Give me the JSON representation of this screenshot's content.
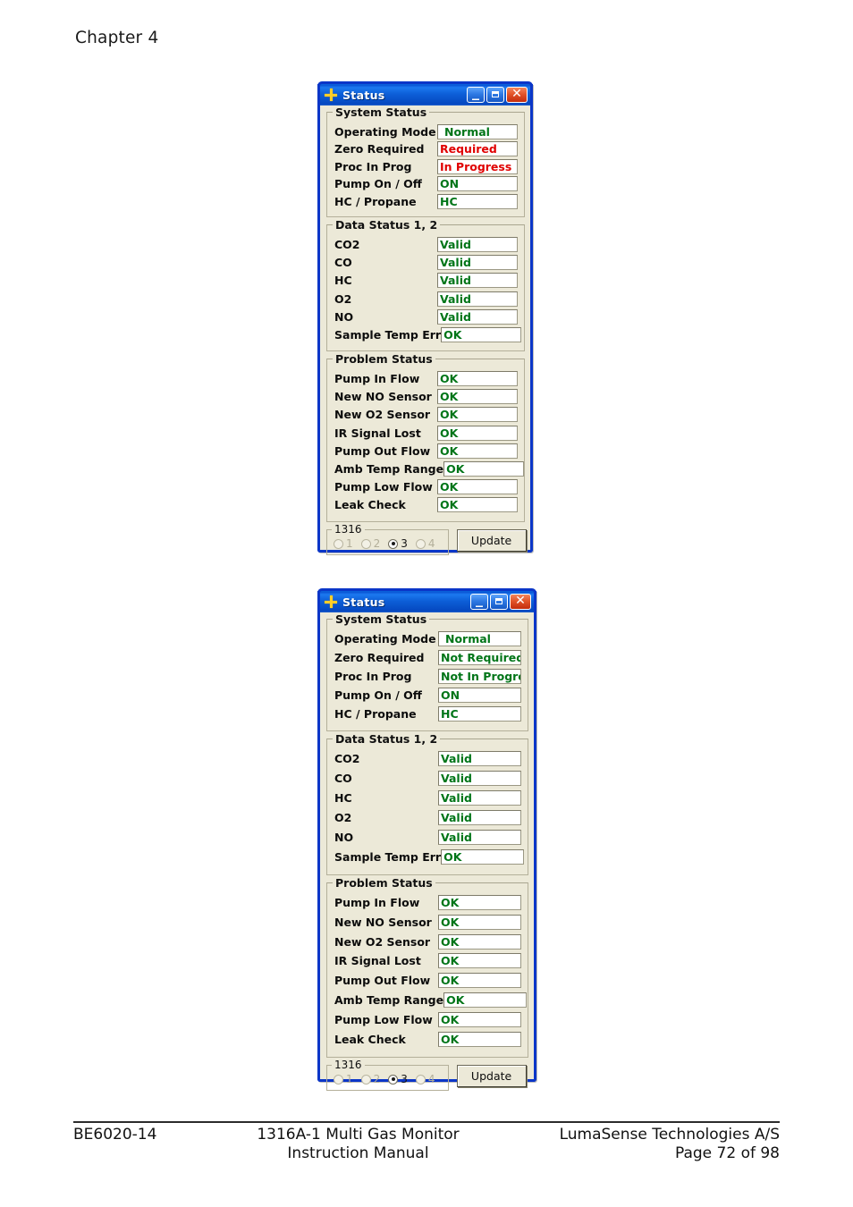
{
  "page": {
    "chapter": "Chapter 4"
  },
  "footer": {
    "left": "BE6020-14",
    "center_line1": "1316A-1 Multi Gas Monitor",
    "center_line2": "Instruction Manual",
    "right_line1": "LumaSense Technologies A/S",
    "right_line2": "Page 72 of 98"
  },
  "colors": {
    "title_blue": "#0b57d6",
    "dialog_face": "#ece9d8",
    "ok_green": "#007518",
    "alert_red": "#e00000"
  },
  "dialogs": [
    {
      "title": "Status",
      "icon": "plus-star-icon",
      "window_buttons": {
        "minimize": "minimize-icon",
        "maximize": "maximize-icon",
        "close": "close-icon"
      },
      "system_status": {
        "legend": "System Status",
        "rows": [
          {
            "label": "Operating Mode",
            "value": "Normal",
            "state": "green",
            "indent": true
          },
          {
            "label": "Zero Required",
            "value": "Required",
            "state": "red",
            "indent": false
          },
          {
            "label": "Proc In Prog",
            "value": "In Progress",
            "state": "red",
            "indent": false
          },
          {
            "label": "Pump On / Off",
            "value": "ON",
            "state": "green",
            "indent": false
          },
          {
            "label": "HC / Propane",
            "value": "HC",
            "state": "green",
            "indent": false
          }
        ]
      },
      "data_status": {
        "legend": "Data Status 1, 2",
        "rows": [
          {
            "label": "CO2",
            "value": "Valid",
            "state": "green"
          },
          {
            "label": "CO",
            "value": "Valid",
            "state": "green"
          },
          {
            "label": "HC",
            "value": "Valid",
            "state": "green"
          },
          {
            "label": "O2",
            "value": "Valid",
            "state": "green"
          },
          {
            "label": "NO",
            "value": "Valid",
            "state": "green"
          },
          {
            "label": "Sample Temp Err",
            "value": "OK",
            "state": "green"
          }
        ]
      },
      "problem_status": {
        "legend": "Problem Status",
        "rows": [
          {
            "label": "Pump In Flow",
            "value": "OK",
            "state": "green"
          },
          {
            "label": "New NO Sensor",
            "value": "OK",
            "state": "green"
          },
          {
            "label": "New O2 Sensor",
            "value": "OK",
            "state": "green"
          },
          {
            "label": "IR Signal Lost",
            "value": "OK",
            "state": "green"
          },
          {
            "label": "Pump Out Flow",
            "value": "OK",
            "state": "green"
          },
          {
            "label": "Amb Temp Range",
            "value": "OK",
            "state": "green"
          },
          {
            "label": "Pump Low Flow",
            "value": "OK",
            "state": "green"
          },
          {
            "label": "Leak Check",
            "value": "OK",
            "state": "green"
          }
        ]
      },
      "device_group": {
        "legend": "1316",
        "options": [
          {
            "label": "1",
            "selected": false,
            "enabled": false
          },
          {
            "label": "2",
            "selected": false,
            "enabled": false
          },
          {
            "label": "3",
            "selected": true,
            "enabled": true
          },
          {
            "label": "4",
            "selected": false,
            "enabled": false
          }
        ]
      },
      "update_button": "Update"
    },
    {
      "title": "Status",
      "icon": "plus-star-icon",
      "window_buttons": {
        "minimize": "minimize-icon",
        "maximize": "maximize-icon",
        "close": "close-icon"
      },
      "system_status": {
        "legend": "System Status",
        "rows": [
          {
            "label": "Operating Mode",
            "value": "Normal",
            "state": "green",
            "indent": true
          },
          {
            "label": "Zero Required",
            "value": "Not Required",
            "state": "green",
            "indent": false
          },
          {
            "label": "Proc In Prog",
            "value": "Not In Progress",
            "state": "green",
            "indent": false
          },
          {
            "label": "Pump On / Off",
            "value": "ON",
            "state": "green",
            "indent": false
          },
          {
            "label": "HC / Propane",
            "value": "HC",
            "state": "green",
            "indent": false
          }
        ]
      },
      "data_status": {
        "legend": "Data Status 1, 2",
        "rows": [
          {
            "label": "CO2",
            "value": "Valid",
            "state": "green"
          },
          {
            "label": "CO",
            "value": "Valid",
            "state": "green"
          },
          {
            "label": "HC",
            "value": "Valid",
            "state": "green"
          },
          {
            "label": "O2",
            "value": "Valid",
            "state": "green"
          },
          {
            "label": "NO",
            "value": "Valid",
            "state": "green"
          },
          {
            "label": "Sample Temp Err",
            "value": "OK",
            "state": "green"
          }
        ]
      },
      "problem_status": {
        "legend": "Problem Status",
        "rows": [
          {
            "label": "Pump In Flow",
            "value": "OK",
            "state": "green"
          },
          {
            "label": "New NO Sensor",
            "value": "OK",
            "state": "green"
          },
          {
            "label": "New O2 Sensor",
            "value": "OK",
            "state": "green"
          },
          {
            "label": "IR Signal Lost",
            "value": "OK",
            "state": "green"
          },
          {
            "label": "Pump Out Flow",
            "value": "OK",
            "state": "green"
          },
          {
            "label": "Amb Temp Range",
            "value": "OK",
            "state": "green"
          },
          {
            "label": "Pump Low Flow",
            "value": "OK",
            "state": "green"
          },
          {
            "label": "Leak Check",
            "value": "OK",
            "state": "green"
          }
        ]
      },
      "device_group": {
        "legend": "1316",
        "options": [
          {
            "label": "1",
            "selected": false,
            "enabled": false
          },
          {
            "label": "2",
            "selected": false,
            "enabled": false
          },
          {
            "label": "3",
            "selected": true,
            "enabled": true
          },
          {
            "label": "4",
            "selected": false,
            "enabled": false
          }
        ]
      },
      "update_button": "Update"
    }
  ]
}
